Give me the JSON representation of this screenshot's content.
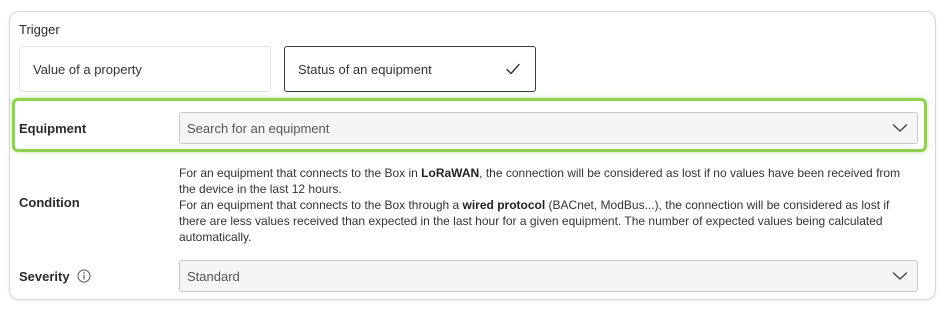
{
  "trigger": {
    "label": "Trigger",
    "options": [
      {
        "label": "Value of a property",
        "selected": false
      },
      {
        "label": "Status of an equipment",
        "selected": true
      }
    ]
  },
  "equipment": {
    "label": "Equipment",
    "placeholder": "Search for an equipment",
    "icon": "chevron-down-icon"
  },
  "condition": {
    "label": "Condition",
    "line1_pre": "For an equipment that connects to the Box in ",
    "line1_bold": "LoRaWAN",
    "line1_post": ", the connection will be considered as lost if no values have been received from the device in the last 12 hours.",
    "line2_pre": "For an equipment that connects to the Box through a ",
    "line2_bold": "wired protocol",
    "line2_post": " (BACnet, ModBus...), the connection will be considered as lost if there are less values received than expected in the last hour for a given equipment. The number of expected values being calculated automatically."
  },
  "severity": {
    "label": "Severity",
    "value": "Standard",
    "info_icon": "info-icon",
    "icon": "chevron-down-icon"
  },
  "colors": {
    "highlight": "#8fd14f",
    "selected_border": "#3a3a3a"
  }
}
